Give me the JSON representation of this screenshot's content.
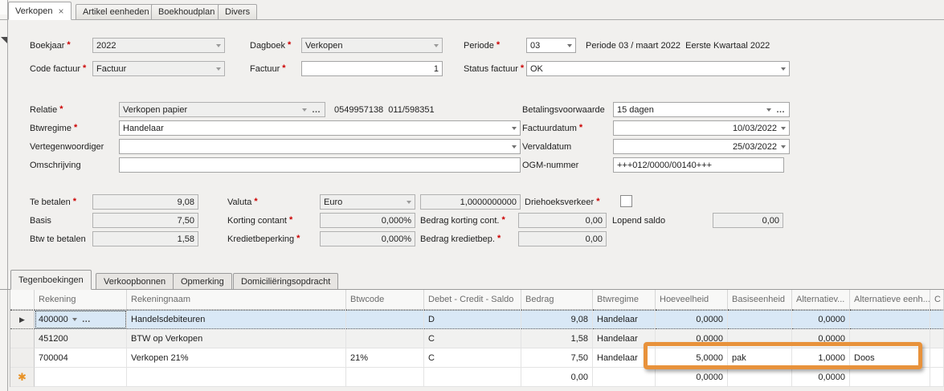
{
  "colors": {
    "annotation_orange": "#e8923b",
    "selected_row_blue": "#d9e8f6",
    "required_red": "#cc0000",
    "panel_background": "#f1f0ee"
  },
  "main_tabs": {
    "close_glyph": "×",
    "items": [
      {
        "label": "Verkopen",
        "active": true,
        "closable": true
      },
      {
        "label": "Artikel eenheden",
        "active": false
      },
      {
        "label": "Boekhoudplan",
        "active": false
      },
      {
        "label": "Divers",
        "active": false
      }
    ]
  },
  "fields": {
    "boekjaar": {
      "label": "Boekjaar",
      "value": "2022",
      "required": true
    },
    "dagboek": {
      "label": "Dagboek",
      "value": "Verkopen",
      "required": true
    },
    "periode": {
      "label": "Periode",
      "value": "03",
      "required": true,
      "info": "Periode 03 / maart 2022  Eerste Kwartaal 2022"
    },
    "code_factuur": {
      "label": "Code factuur",
      "value": "Factuur",
      "required": true
    },
    "factuur": {
      "label": "Factuur",
      "value": "1",
      "required": true
    },
    "status_factuur": {
      "label": "Status factuur",
      "value": "OK",
      "required": true
    },
    "relatie": {
      "label": "Relatie",
      "value": "Verkopen papier",
      "required": true,
      "info": "0549957138  011/598351"
    },
    "betalingsvoorwaarde": {
      "label": "Betalingsvoorwaarde",
      "value": "15 dagen",
      "required": false
    },
    "btwregime": {
      "label": "Btwregime",
      "value": "Handelaar",
      "required": true
    },
    "factuurdatum": {
      "label": "Factuurdatum",
      "value": "10/03/2022",
      "required": true
    },
    "vertegenwoordiger": {
      "label": "Vertegenwoordiger",
      "value": "",
      "required": false
    },
    "vervaldatum": {
      "label": "Vervaldatum",
      "value": "25/03/2022",
      "required": false
    },
    "omschrijving": {
      "label": "Omschrijving",
      "value": "",
      "required": false
    },
    "ogm_nummer": {
      "label": "OGM-nummer",
      "value": "+++012/0000/00140+++",
      "required": false
    },
    "te_betalen": {
      "label": "Te betalen",
      "value": "9,08",
      "required": true
    },
    "valuta": {
      "label": "Valuta",
      "value": "Euro",
      "rate": "1,0000000000",
      "required": true
    },
    "driehoeksverkeer": {
      "label": "Driehoeksverkeer",
      "checked": false,
      "required": true
    },
    "basis": {
      "label": "Basis",
      "value": "7,50",
      "required": false
    },
    "korting_contant": {
      "label": "Korting contant",
      "value": "0,000%",
      "required": true
    },
    "bedrag_korting": {
      "label": "Bedrag korting cont.",
      "value": "0,00",
      "required": true
    },
    "lopend_saldo": {
      "label": "Lopend saldo",
      "value": "0,00",
      "required": false
    },
    "btw_te_betalen": {
      "label": "Btw te betalen",
      "value": "1,58",
      "required": false
    },
    "kredietbeperking": {
      "label": "Kredietbeperking",
      "value": "0,000%",
      "required": true
    },
    "bedrag_kredietbep": {
      "label": "Bedrag kredietbep.",
      "value": "0,00",
      "required": true
    }
  },
  "bottom_tabs": {
    "items": [
      {
        "label": "Tegenboekingen",
        "active": true
      },
      {
        "label": "Verkoopbonnen",
        "active": false
      },
      {
        "label": "Opmerking",
        "active": false
      },
      {
        "label": "Domiciliëringsopdracht",
        "active": false
      }
    ]
  },
  "grid": {
    "columns": [
      "Rekening",
      "Rekeningnaam",
      "Btwcode",
      "Debet - Credit - Saldo",
      "Bedrag",
      "Btwregime",
      "Hoeveelheid",
      "Basiseenheid",
      "Alternatiev...",
      "Alternatieve eenh...",
      "C"
    ],
    "row_indicator_glyph": "▶",
    "new_row_glyph": "✱",
    "rows": [
      {
        "cells": [
          "400000",
          "Handelsdebiteuren",
          "",
          "D",
          "9,08",
          "Handelaar",
          "0,0000",
          "",
          "0,0000",
          "",
          ""
        ]
      },
      {
        "cells": [
          "451200",
          "BTW op Verkopen",
          "",
          "C",
          "1,58",
          "Handelaar",
          "0,0000",
          "",
          "0,0000",
          "",
          ""
        ]
      },
      {
        "cells": [
          "700004",
          "Verkopen 21%",
          "21%",
          "C",
          "7,50",
          "Handelaar",
          "5,0000",
          "pak",
          "1,0000",
          "Doos",
          ""
        ]
      },
      {
        "cells": [
          "",
          "",
          "",
          "",
          "0,00",
          "",
          "0,0000",
          "",
          "0,0000",
          "",
          ""
        ]
      }
    ]
  }
}
